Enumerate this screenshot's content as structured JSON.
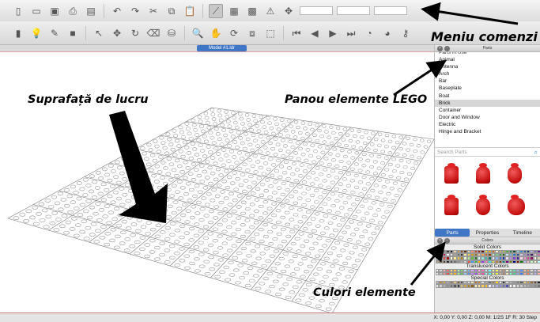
{
  "toolbar1": {
    "icons": [
      "new-file-icon",
      "open-folder-icon",
      "save-icon",
      "print-icon",
      "print-preview-icon",
      "undo-icon",
      "redo-icon",
      "cut-icon",
      "copy-icon",
      "paste-icon",
      "select-tool-icon",
      "snap-grid-icon",
      "quick-select-icon",
      "axis-icon",
      "transform-icon"
    ],
    "glyphs": [
      "▯",
      "▭",
      "▣",
      "⎙",
      "▤",
      "↶",
      "↷",
      "✂",
      "⧉",
      "📋",
      "⟋",
      "▦",
      "▩",
      "⚠",
      "✥"
    ],
    "fields": [
      "",
      "",
      ""
    ]
  },
  "toolbar2": {
    "icons": [
      "new-part-icon",
      "light-icon",
      "paint-icon",
      "camera-icon",
      "cursor-icon",
      "move-icon",
      "rotate-icon",
      "eraser-icon",
      "color-fill-icon",
      "zoom-icon",
      "pan-hand-icon",
      "rotate-view-icon",
      "zoom-region-icon",
      "zoom-extents-icon",
      "first-step-icon",
      "previous-step-icon",
      "next-step-icon",
      "last-step-icon",
      "add-step-icon",
      "remove-step-icon",
      "key-icon"
    ],
    "glyphs": [
      "▮",
      "💡",
      "✎",
      "■",
      "↖",
      "✥",
      "↻",
      "⌫",
      "⛁",
      "🔍",
      "✋",
      "⟳",
      "⧈",
      "⬚",
      "⏮",
      "◀",
      "▶",
      "⏭",
      "◔",
      "◕",
      "⚷"
    ]
  },
  "annotations": {
    "menu": "Meniu comenzi",
    "workspace": "Suprafață de lucru",
    "parts_panel": "Panou elemente LEGO",
    "colors": "Culori elemente"
  },
  "tab": {
    "label": "Model #1.ldr"
  },
  "parts_panel": {
    "title": "Parts",
    "categories": [
      "Parts in Use",
      "Animal",
      "Antenna",
      "Arch",
      "Bar",
      "Baseplate",
      "Boat",
      "Brick",
      "Container",
      "Door and Window",
      "Electric",
      "Hinge and Bracket"
    ],
    "selected_index": 7,
    "search_placeholder": "Search Parts",
    "tabs": [
      "Parts",
      "Properties",
      "Timeline"
    ],
    "active_tab": 0
  },
  "colors_panel": {
    "title": "Colors",
    "sections": [
      "Solid Colors",
      "Translucent Colors",
      "Special Colors"
    ],
    "solid": [
      "#f2f2f2",
      "#c0c0c0",
      "#8a8a8a",
      "#3c3c3c",
      "#111111",
      "#e8d6a8",
      "#c99a5b",
      "#8a4b1e",
      "#5a2c0c",
      "#ffd2c0",
      "#ff8c6a",
      "#e23b2e",
      "#9c1c1c",
      "#5c0a0a",
      "#f7e21b",
      "#f0a800",
      "#e06d10",
      "#ffeccc",
      "#d8b36e",
      "#9acd32",
      "#58ab41",
      "#237841",
      "#0f4b2c",
      "#7dd3e8",
      "#3a8fd8",
      "#1e5aa8",
      "#0d2e6e",
      "#b9a7e6",
      "#8a55c9",
      "#5b1f8c",
      "#ff9ec8",
      "#e95fa0",
      "#c2185b",
      "#ffffff",
      "#e4e4e4",
      "#a6a6a6",
      "#6b6b6b",
      "#2a2a2a",
      "#fff2a8",
      "#ffd94a",
      "#d4a017",
      "#a07010",
      "#ffc8a0",
      "#ff9e50",
      "#d15f0a",
      "#8f3a00",
      "#c8f0c8",
      "#7ad07a",
      "#3aa63a",
      "#1e6e1e",
      "#c8e8ff",
      "#7ab8f0",
      "#2e78c8",
      "#164a8a",
      "#d8c8f0",
      "#a88ad8",
      "#6a3aa8",
      "#3e1a6a",
      "#f0c8e0",
      "#c870a8",
      "#ffe0e0",
      "#ff9a9a",
      "#e04848",
      "#a01818",
      "#fff8d8",
      "#ffe98a",
      "#e8c040",
      "#b08818",
      "#e8ffd8",
      "#b0e890",
      "#68b848",
      "#2e7820",
      "#d8fff8",
      "#90e8d8",
      "#40b8a8",
      "#107868",
      "#d8e8ff",
      "#90b0f0",
      "#4870d0",
      "#1838a0",
      "#e8d8ff",
      "#b890f0",
      "#8048d0",
      "#4818a0",
      "#ffd8f0",
      "#f090c8",
      "#d04898",
      "#901860",
      "#f4f0e8",
      "#d8ccb8",
      "#b8a890",
      "#887050",
      "#584028",
      "#303030",
      "#505050",
      "#707070",
      "#909090",
      "#b0b0b0",
      "#d0d0d0",
      "#ff4040",
      "#40a0ff",
      "#40c040",
      "#ffc000",
      "#a040ff",
      "#ff80c0",
      "#40e0e0",
      "#e0e040",
      "#c08040",
      "#804000",
      "#008080",
      "#800080",
      "#808000",
      "#000080",
      "#800000",
      "#008000",
      "#c0c0ff",
      "#ffc0c0",
      "#c0ffc0",
      "#ffffc0",
      "#c0ffff"
    ],
    "translucent": [
      "#f8f8f8",
      "#dcdcdc",
      "#ffb0b0",
      "#ff7070",
      "#ffe070",
      "#ffc040",
      "#b0ffb0",
      "#70e070",
      "#b0e0ff",
      "#70b0ff",
      "#d0b0ff",
      "#b070ff",
      "#ffb0e0",
      "#ff70c0",
      "#c0ffff",
      "#70ffff",
      "#ffffa0",
      "#ffff60",
      "#e0c0a0",
      "#c09070",
      "#f0f0c0",
      "#a0ffd0",
      "#60e0b0",
      "#a0c0ff",
      "#6090ff",
      "#ffc0a0",
      "#ff9060",
      "#e0e0e0",
      "#c8c8ff",
      "#ffc8c8",
      "#f0f0f0",
      "#c0c0c0",
      "#ff9090",
      "#ff5050",
      "#ffd050",
      "#ffb020",
      "#90ff90",
      "#50d050",
      "#90d0ff",
      "#5090ff",
      "#c090ff",
      "#9050ff",
      "#ff90d0",
      "#ff50b0",
      "#a0ffff",
      "#50f0f0",
      "#ffff80",
      "#f0f040",
      "#d0b090",
      "#b08060",
      "#e8e8b0",
      "#80ffc0",
      "#40d0a0",
      "#80b0ff",
      "#4080ff",
      "#ffb090",
      "#ff8050",
      "#d0d0d0",
      "#b0b0ff",
      "#ffb0b0"
    ],
    "special": [
      "#c9c9c9",
      "#b38b3c",
      "#d4af37",
      "#a8a8a8",
      "#8c7853",
      "#e6c87a",
      "#7b5e2e",
      "#505050",
      "#c0c0c0",
      "#dedede",
      "#f5e6a6",
      "#b87333",
      "#cd7f32",
      "#e5e4e2",
      "#aaa9ad",
      "#6e6e6e",
      "#9c7c38",
      "#ffd700",
      "#e8e8e8",
      "#333333",
      "#d8d8d8",
      "#b8b8b8",
      "#989898",
      "#787878",
      "#585858",
      "#f2d16b",
      "#c6a34a",
      "#a0702a",
      "#604020",
      "#202020",
      "#ededed",
      "#cfcfcf",
      "#b1b1b1",
      "#939393",
      "#757575",
      "#575757",
      "#393939",
      "#e0c070",
      "#c8a050",
      "#a88030",
      "#886010",
      "#fff0c0",
      "#ffe090",
      "#ffd060",
      "#ffc030",
      "#f0f0ff",
      "#d0d0f0",
      "#b0b0e0",
      "#9090d0",
      "#7070c0",
      "#5050b0",
      "#fff",
      "#eee",
      "#ddd",
      "#ccc",
      "#bbb",
      "#aaa",
      "#999",
      "#888",
      "#777"
    ]
  },
  "status": {
    "text": "X: 0,00 Y: 0,00 Z: 0,00   M: 1/2S 1F R: 30   Step"
  },
  "accent_color": "#3f76c5"
}
